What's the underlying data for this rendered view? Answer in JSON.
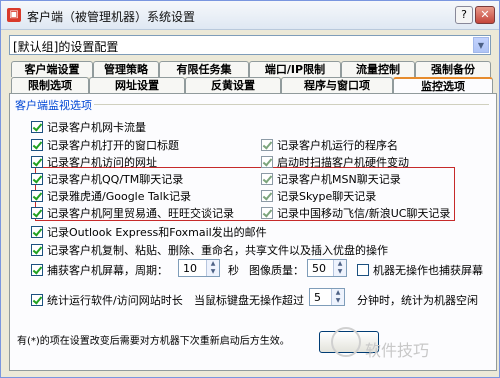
{
  "window": {
    "title": "客户端（被管理机器）系统设置",
    "help_glyph": "?",
    "close_glyph": "✕"
  },
  "profile_select": {
    "value": "[默认组]的设置配置"
  },
  "tabs_row1": [
    "客户端设置",
    "管理策略",
    "有限任务集",
    "端口/IP限制",
    "流量控制",
    "强制备份"
  ],
  "tabs_row2": [
    "限制选项",
    "网址设置",
    "反黄设置",
    "程序与窗口项",
    "监控选项"
  ],
  "group": {
    "title": "客户端监视选项"
  },
  "options": {
    "nic_traffic": {
      "label": "记录客户机网卡流量",
      "checked": true
    },
    "programs": {
      "label": "记录客户机运行的程序名",
      "checked": true
    },
    "window_titles": {
      "label": "记录客户机打开的窗口标题",
      "checked": true
    },
    "hardware_change": {
      "label": "启动时扫描客户机硬件变动",
      "checked": true
    },
    "urls": {
      "label": "记录客户机访问的网址",
      "checked": true
    },
    "qq_chat": {
      "label": "记录客户机QQ/TM聊天记录",
      "checked": true
    },
    "msn_chat": {
      "label": "记录客户机MSN聊天记录",
      "checked": true
    },
    "yahoo_gtalk": {
      "label": "记录雅虎通/Google Talk记录",
      "checked": true
    },
    "skype_chat": {
      "label": "记录Skype聊天记录",
      "checked": true
    },
    "aliwangwang": {
      "label": "记录客户机阿里贸易通、旺旺交谈记录",
      "checked": true
    },
    "fetion_uc": {
      "label": "记录中国移动飞信/新浪UC聊天记录",
      "checked": true
    },
    "mail": {
      "label": "记录Outlook Express和Foxmail发出的邮件",
      "checked": true
    },
    "file_ops": {
      "label": "记录客户机复制、粘贴、删除、重命名，共享文件以及插入优盘的操作",
      "checked": true
    },
    "screen_capture": {
      "label": "捕获客户机屏幕，周期：",
      "checked": true
    },
    "no_capture_idle": {
      "label": "机器无操作也捕获屏幕",
      "checked": false
    },
    "stats": {
      "label": "统计运行软件/访问网站时长",
      "checked": true
    }
  },
  "screen": {
    "period": "10",
    "period_unit": "秒",
    "quality_label": "图像质量：",
    "quality": "50"
  },
  "stats_row": {
    "idle_label": "当鼠标键盘无操作超过",
    "idle_value": "5",
    "idle_suffix": "分钟时，统计为机器空闲"
  },
  "footer": {
    "note": "有(*)的项在设置改变后需要对方机器下次重新启动后方生效。"
  },
  "watermark": {
    "text": "软件技巧"
  }
}
